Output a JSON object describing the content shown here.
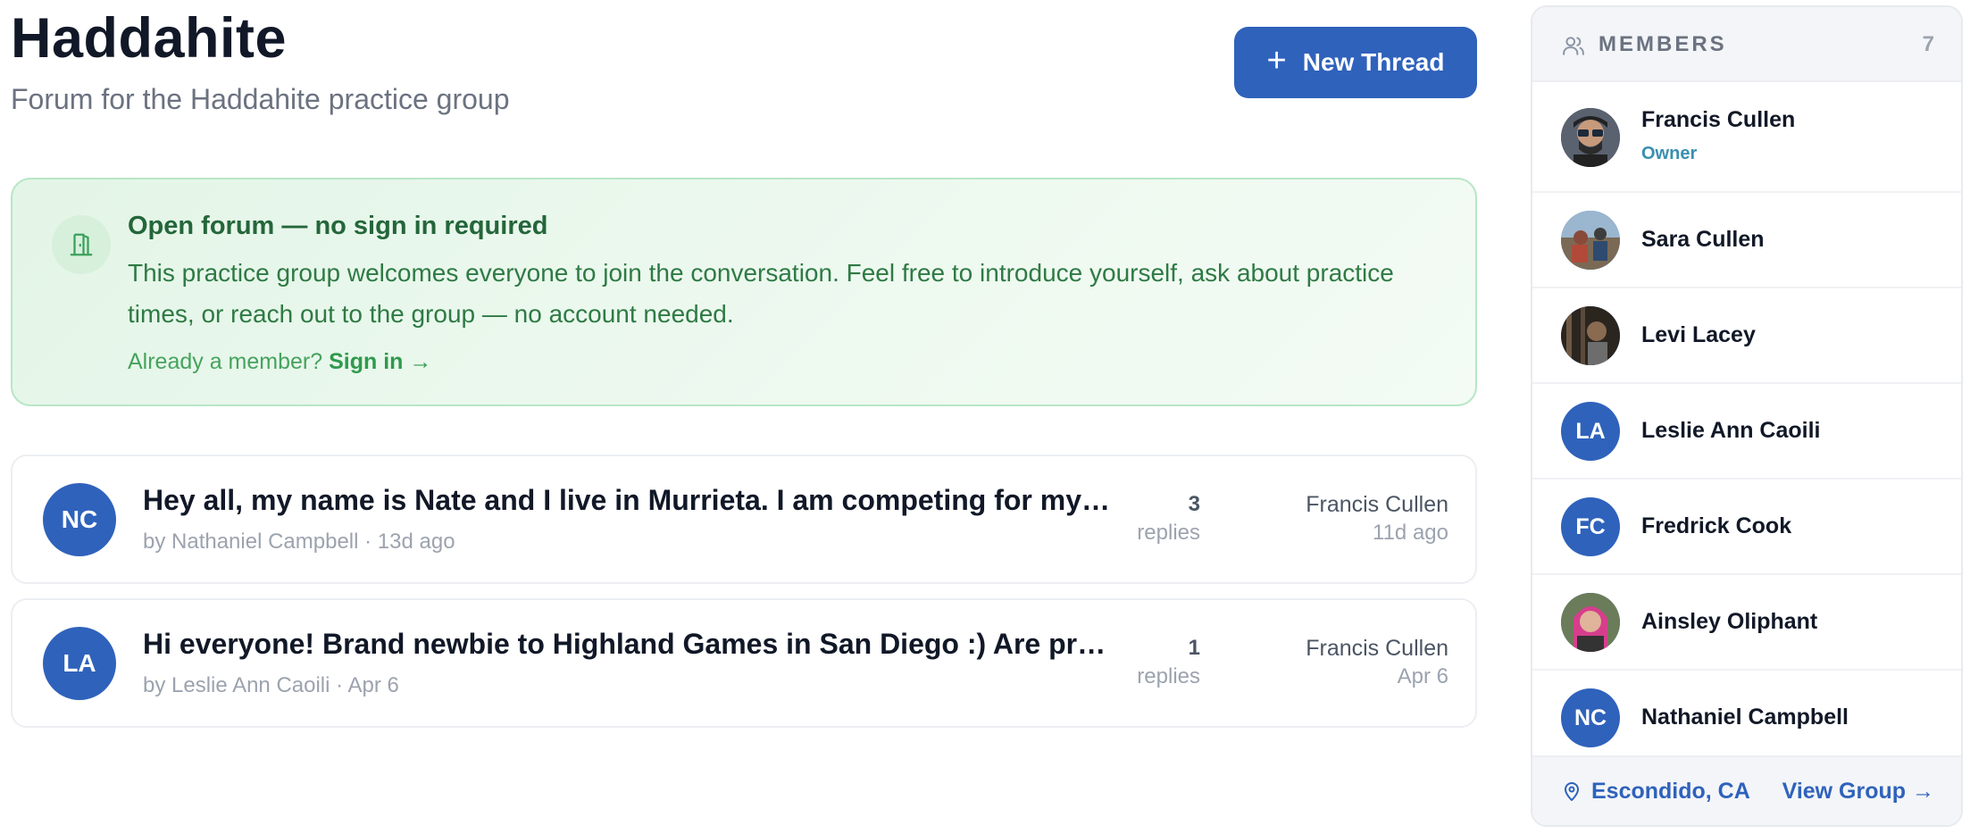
{
  "header": {
    "title": "Haddahite",
    "subtitle": "Forum for the Haddahite practice group",
    "new_thread_icon": "plus-icon",
    "new_thread_label": "New Thread"
  },
  "notice": {
    "icon": "door-icon",
    "title": "Open forum — no sign in required",
    "body": "This practice group welcomes everyone to join the conversation. Feel free to introduce yourself, ask about practice times, or reach out to the group — no account needed.",
    "signin_prompt": "Already a member?",
    "signin_link": "Sign in →"
  },
  "threads": [
    {
      "initials": "NC",
      "title": "Hey all, my name is Nate and I live in Murrieta. I am competing for my first time in Highland Games",
      "meta": "by Nathaniel Campbell · 13d ago",
      "reply_count": "3",
      "replies_label": "replies",
      "last_user": "Francis Cullen",
      "last_time": "11d ago"
    },
    {
      "initials": "LA",
      "title": "Hi everyone! Brand newbie to Highland Games in San Diego :) Are practices open to new people?",
      "meta": "by Leslie Ann Caoili · Apr 6",
      "reply_count": "1",
      "replies_label": "replies",
      "last_user": "Francis Cullen",
      "last_time": "Apr 6"
    }
  ],
  "members": {
    "icon": "users-icon",
    "title": "MEMBERS",
    "count": "7",
    "list": [
      {
        "name": "Francis Cullen",
        "role": "Owner",
        "avatar": "photo"
      },
      {
        "name": "Sara Cullen",
        "role": "",
        "avatar": "photo"
      },
      {
        "name": "Levi Lacey",
        "role": "",
        "avatar": "photo"
      },
      {
        "name": "Leslie Ann Caoili",
        "role": "",
        "initials": "LA"
      },
      {
        "name": "Fredrick Cook",
        "role": "",
        "initials": "FC"
      },
      {
        "name": "Ainsley Oliphant",
        "role": "",
        "avatar": "photo"
      },
      {
        "name": "Nathaniel Campbell",
        "role": "",
        "initials": "NC"
      }
    ],
    "location_icon": "map-pin-icon",
    "location": "Escondido, CA",
    "view_group": "View Group →"
  },
  "colors": {
    "primary": "#2f62bb",
    "notice_bg": "#e3f5e7",
    "notice_text": "#24663a",
    "owner_role": "#3a8fb0"
  }
}
